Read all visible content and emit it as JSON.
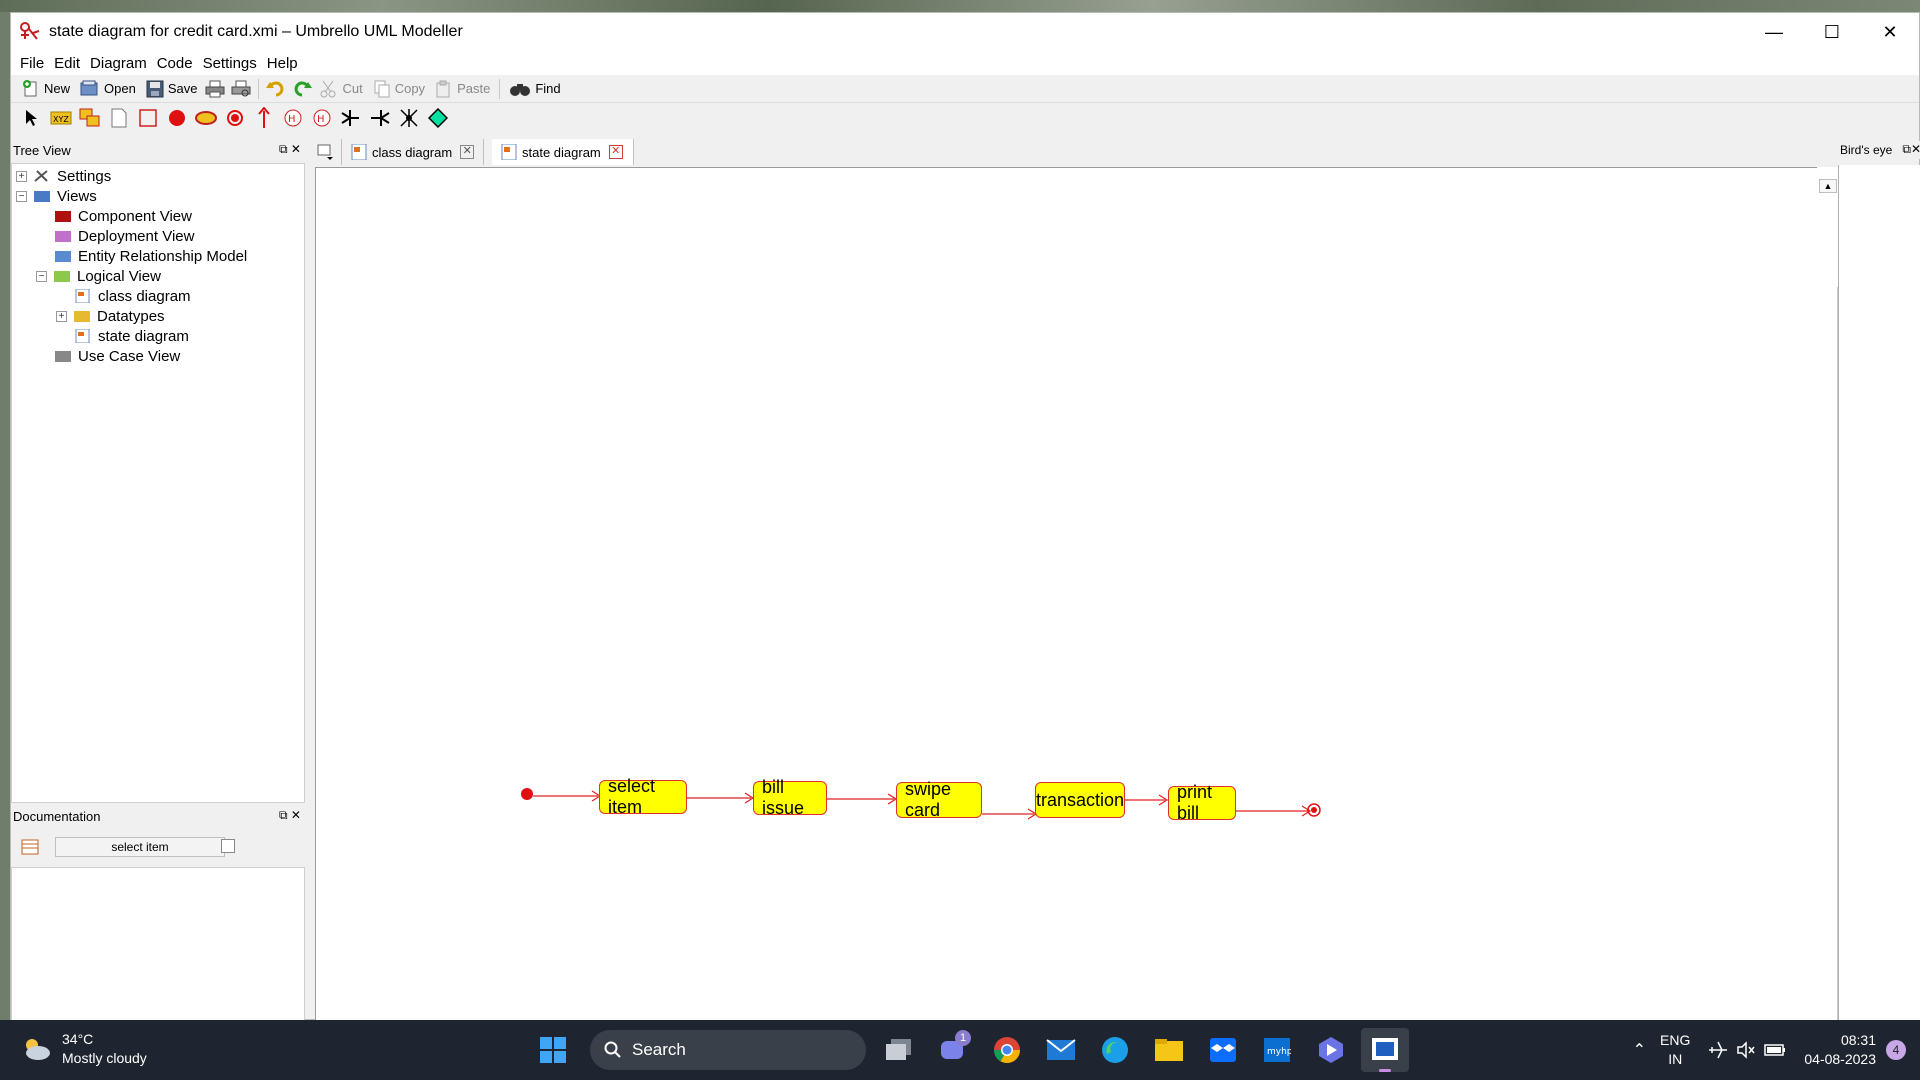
{
  "window": {
    "title": "state diagram for credit card.xmi – Umbrello UML Modeller",
    "controls": [
      "minimize",
      "maximize",
      "close"
    ]
  },
  "menu": [
    "File",
    "Edit",
    "Diagram",
    "Code",
    "Settings",
    "Help"
  ],
  "toolbar": {
    "new_label": "New",
    "open_label": "Open",
    "save_label": "Save",
    "cut_label": "Cut",
    "copy_label": "Copy",
    "paste_label": "Paste",
    "find_label": "Find"
  },
  "tree_view": {
    "title": "Tree View",
    "items": [
      {
        "label": "Settings",
        "icon": "settings-icon",
        "expander": "+"
      },
      {
        "label": "Views",
        "icon": "views-folder-icon",
        "expander": "−"
      },
      {
        "label": "Component View",
        "icon": "component-folder-icon"
      },
      {
        "label": "Deployment View",
        "icon": "deployment-folder-icon"
      },
      {
        "label": "Entity Relationship Model",
        "icon": "er-folder-icon"
      },
      {
        "label": "Logical View",
        "icon": "logical-folder-icon",
        "expander": "−"
      },
      {
        "label": "class diagram",
        "icon": "diagram-icon"
      },
      {
        "label": "Datatypes",
        "icon": "folder-icon",
        "expander": "+"
      },
      {
        "label": "state diagram",
        "icon": "diagram-icon"
      },
      {
        "label": "Use Case View",
        "icon": "usecase-folder-icon"
      }
    ]
  },
  "documentation": {
    "title": "Documentation",
    "field_value": "select item"
  },
  "tabs": [
    {
      "label": "class diagram",
      "active": false
    },
    {
      "label": "state diagram",
      "active": true
    }
  ],
  "birds_eye": {
    "title": "Bird's eye"
  },
  "diagram": {
    "states": [
      "select item",
      "bill issue",
      "swipe card",
      "transaction",
      "print bill"
    ],
    "initial": "initial-state",
    "final": "final-state",
    "colors": {
      "state_fill": "#ffff00",
      "line": "#e02020"
    }
  },
  "taskbar": {
    "weather_temp": "34°C",
    "weather_desc": "Mostly cloudy",
    "search_placeholder": "Search",
    "chat_badge": "1",
    "lang_top": "ENG",
    "lang_bottom": "IN",
    "time": "08:31",
    "date": "04-08-2023",
    "notifications": "4"
  }
}
